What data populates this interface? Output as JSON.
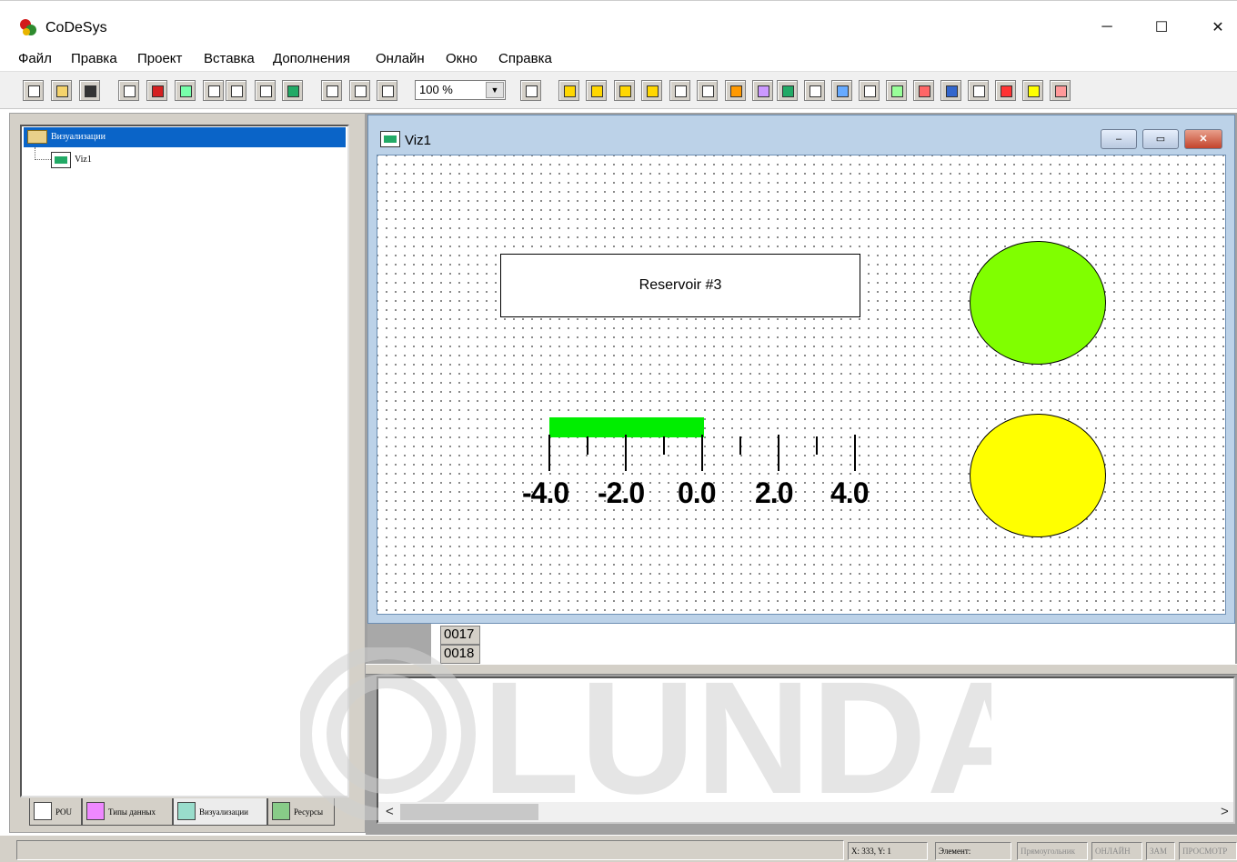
{
  "window": {
    "title": "CoDeSys",
    "minimize": "─",
    "maximize": "☐",
    "close": "✕"
  },
  "menu": {
    "items": [
      {
        "label": "Файл"
      },
      {
        "label": "Правка"
      },
      {
        "label": "Проект"
      },
      {
        "label": "Вставка"
      },
      {
        "label": "Дополнения"
      },
      {
        "label": "Онлайн"
      },
      {
        "label": "Окно"
      },
      {
        "label": "Справка"
      }
    ]
  },
  "toolbar": {
    "zoom_value": "100 %",
    "zoom_arrow": "▼"
  },
  "tree": {
    "root_label": "Визуализации",
    "child_label": "Viz1"
  },
  "bottom_tabs": [
    {
      "label": "POU"
    },
    {
      "label": "Типы данных"
    },
    {
      "label": "Визуализации"
    },
    {
      "label": "Ресурсы"
    }
  ],
  "viz_window": {
    "title": "Viz1",
    "btn_min": "–",
    "btn_restore": "▭",
    "btn_close": "✕"
  },
  "visualization": {
    "reservoir_label": "Reservoir #3",
    "bar_value": 0.0,
    "bar_min": -4.0,
    "bar_max": 6.0,
    "scale_labels": [
      "-4.0",
      "-2.0",
      "0.0",
      "2.0",
      "4.0"
    ],
    "lamp_top_color": "#80ff00",
    "lamp_bottom_color": "#ffff00",
    "bar_color": "#00ee00"
  },
  "editor": {
    "line_numbers": [
      "0017",
      "0018"
    ]
  },
  "messages": {
    "scroll_left": "<",
    "scroll_right": ">"
  },
  "watermark": "LUNDA",
  "status": {
    "coords": "X: 333, Y: 1",
    "element": "Элемент:",
    "shape": "Прямоугольник",
    "online": "ОНЛАЙН",
    "zam": "ЗАМ",
    "view": "ПРОСМОТР"
  }
}
